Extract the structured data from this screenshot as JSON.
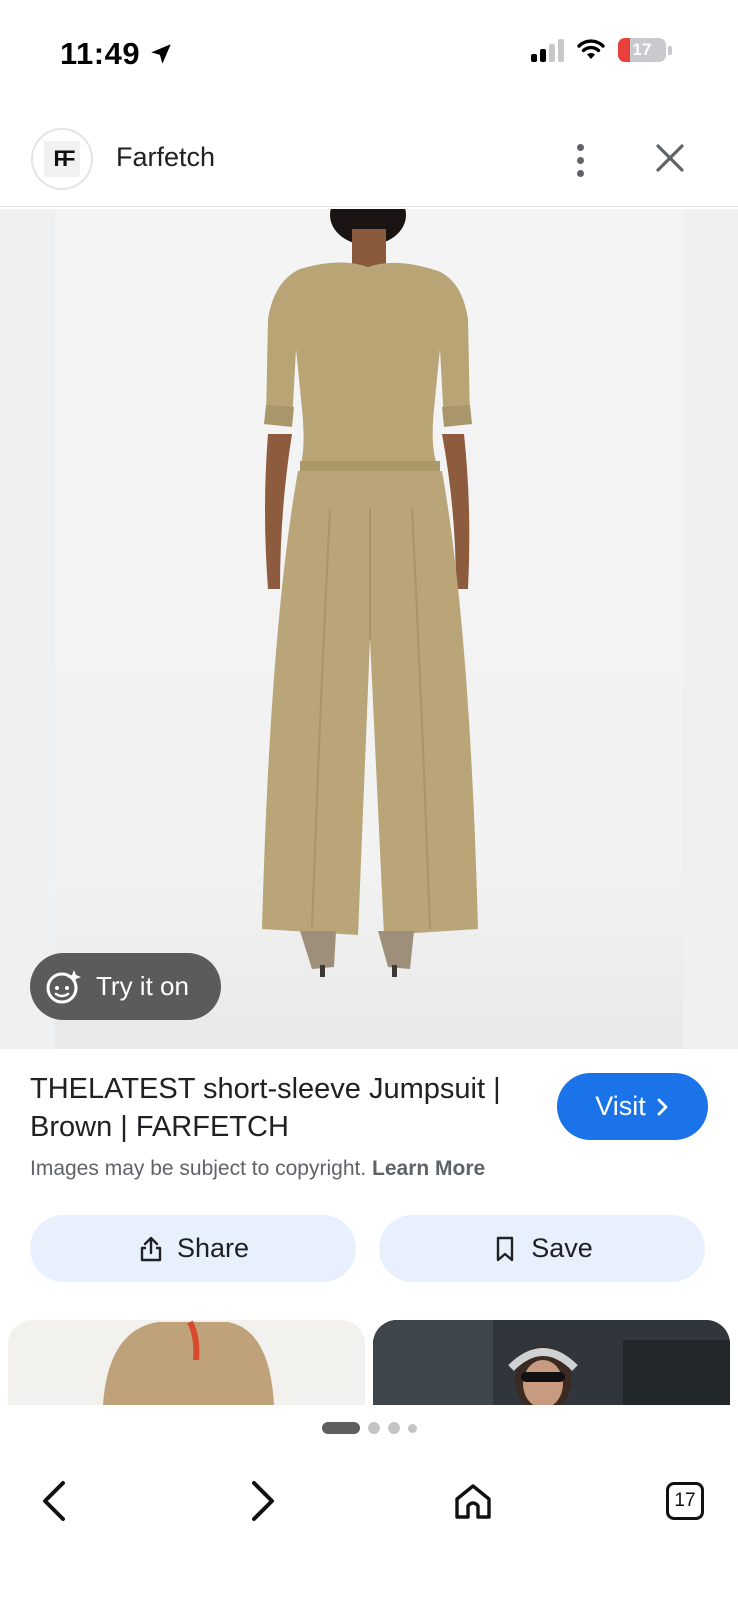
{
  "status_bar": {
    "time": "11:49",
    "battery": "17",
    "icons": [
      "location-arrow-icon",
      "cellular-signal-icon",
      "wifi-icon",
      "battery-icon"
    ]
  },
  "header": {
    "site_logo_text": "FF",
    "site_name": "Farfetch",
    "icons": [
      "more-vertical-icon",
      "close-icon"
    ]
  },
  "image": {
    "try_on_label": "Try it on"
  },
  "product": {
    "title": "THELATEST short-sleeve Jumpsuit | Brown | FARFETCH",
    "visit_label": "Visit",
    "copyright_text": "Images may be subject to copyright.",
    "learn_more": "Learn More"
  },
  "actions": {
    "share_label": "Share",
    "save_label": "Save"
  },
  "toolbar": {
    "tab_count": "17",
    "icons": [
      "back-arrow-icon",
      "forward-arrow-icon",
      "home-icon",
      "tabs-icon"
    ]
  },
  "colors": {
    "accent": "#1a73e8",
    "action_bg": "#e8f0fe",
    "try_on_bg": "#5b5b5b",
    "garment": "#b9a577"
  }
}
